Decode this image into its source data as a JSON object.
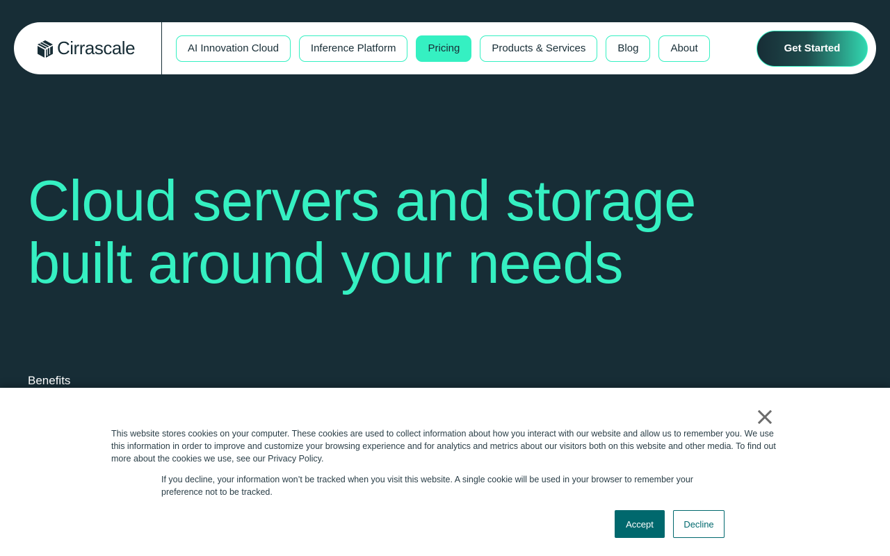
{
  "brand": {
    "name": "Cirrascale",
    "icon": "cirrascale-logo-icon"
  },
  "nav": {
    "items": [
      {
        "label": "AI Innovation Cloud",
        "active": false
      },
      {
        "label": "Inference Platform",
        "active": false
      },
      {
        "label": "Pricing",
        "active": true
      },
      {
        "label": "Products & Services",
        "active": false
      },
      {
        "label": "Blog",
        "active": false
      },
      {
        "label": "About",
        "active": false
      }
    ],
    "cta_label": "Get Started"
  },
  "hero": {
    "title_line1": "Cloud servers and storage",
    "title_line2": "built around your needs",
    "section_label": "Benefits"
  },
  "cookie_banner": {
    "text_main": "This website stores cookies on your computer. These cookies are used to collect information about how you interact with our website and allow us to remember you. We use this information in order to improve and customize your browsing experience and for analytics and metrics about our visitors both on this website and other media. To find out more about the cookies we use, see our Privacy Policy.",
    "text_decline": "If you decline, your information won’t be tracked when you visit this website. A single cookie will be used in your browser to remember your preference not to be tracked.",
    "accept_label": "Accept",
    "decline_label": "Decline",
    "close_icon": "close-icon"
  },
  "colors": {
    "background": "#172d36",
    "accent": "#35f0c2",
    "button_teal": "#00686d"
  }
}
